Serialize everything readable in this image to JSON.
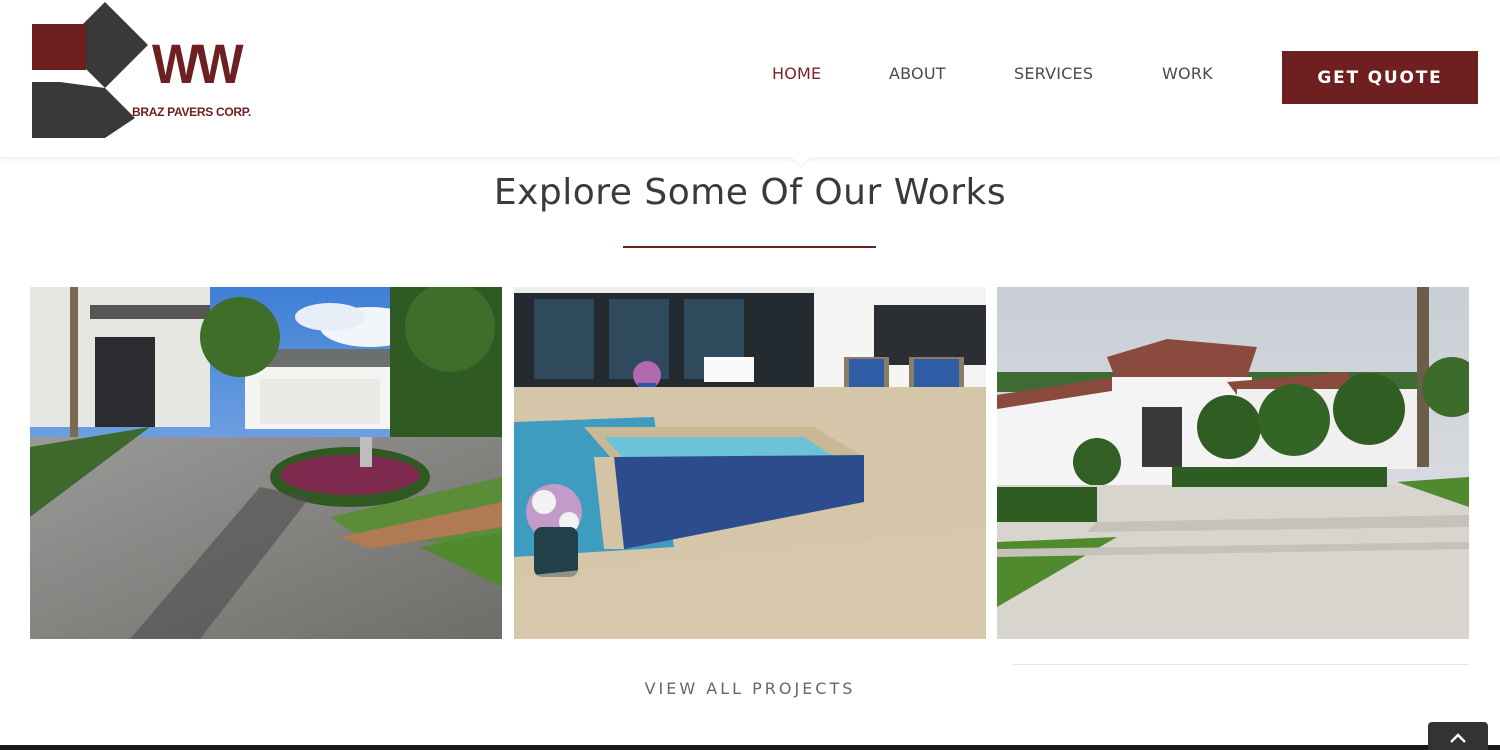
{
  "brand": {
    "logo_mark": "WW",
    "logo_subtitle": "BRAZ PAVERS CORP.",
    "primary_color": "#6e2020"
  },
  "nav": {
    "items": [
      {
        "label": "HOME",
        "active": true
      },
      {
        "label": "ABOUT",
        "active": false
      },
      {
        "label": "SERVICES",
        "active": false
      },
      {
        "label": "WORK",
        "active": false
      }
    ],
    "cta_label": "GET QUOTE"
  },
  "works": {
    "title": "Explore Some Of Our Works",
    "projects": [
      {
        "image": "driveway-with-garage-and-palms"
      },
      {
        "image": "pool-deck-with-spa"
      },
      {
        "image": "white-house-with-paver-driveway"
      }
    ],
    "view_all_label": "VIEW ALL PROJECTS"
  },
  "icons": {
    "back_to_top": "chevron-up-icon"
  }
}
